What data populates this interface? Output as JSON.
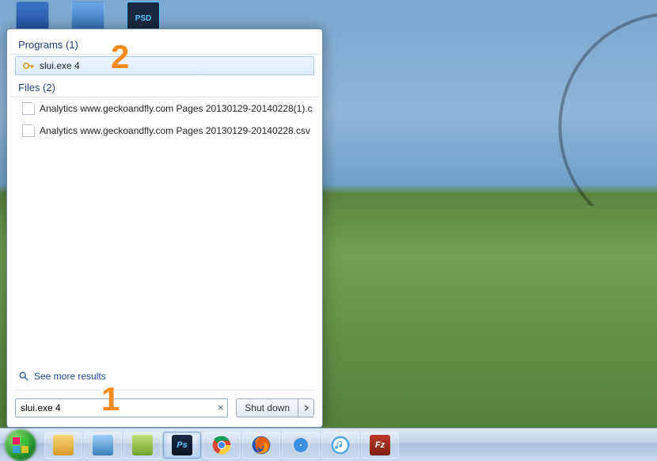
{
  "annotations": {
    "step1": "1",
    "step2": "2"
  },
  "start_panel": {
    "programs_header": "Programs (1)",
    "programs": [
      {
        "label": "slui.exe 4",
        "selected": true
      }
    ],
    "files_header": "Files (2)",
    "files": [
      {
        "label": "Analytics www.geckoandfly.com Pages 20130129-20140228(1).c..."
      },
      {
        "label": "Analytics www.geckoandfly.com Pages 20130129-20140228.csv"
      }
    ],
    "see_more": "See more results",
    "search_value": "slui.exe 4",
    "shutdown_label": "Shut down"
  },
  "taskbar": {
    "items": [
      {
        "name": "file-explorer",
        "color1": "#f7d774",
        "color2": "#d89a2b"
      },
      {
        "name": "calculator",
        "color1": "#9ed0f5",
        "color2": "#3a7fb8"
      },
      {
        "name": "notepad-plus",
        "color1": "#c4e27c",
        "color2": "#6fa52b"
      },
      {
        "name": "photoshop",
        "color1": "#1d2b46",
        "color2": "#0a1424",
        "active": true,
        "text": "Ps",
        "tcolor": "#55c7ff"
      },
      {
        "name": "chrome",
        "svg": "chrome"
      },
      {
        "name": "firefox",
        "svg": "firefox"
      },
      {
        "name": "safari",
        "svg": "safari"
      },
      {
        "name": "itunes",
        "svg": "itunes"
      },
      {
        "name": "filezilla",
        "color1": "#c0392b",
        "color2": "#7b1e14",
        "text": "Fz",
        "tcolor": "#fff"
      }
    ]
  }
}
